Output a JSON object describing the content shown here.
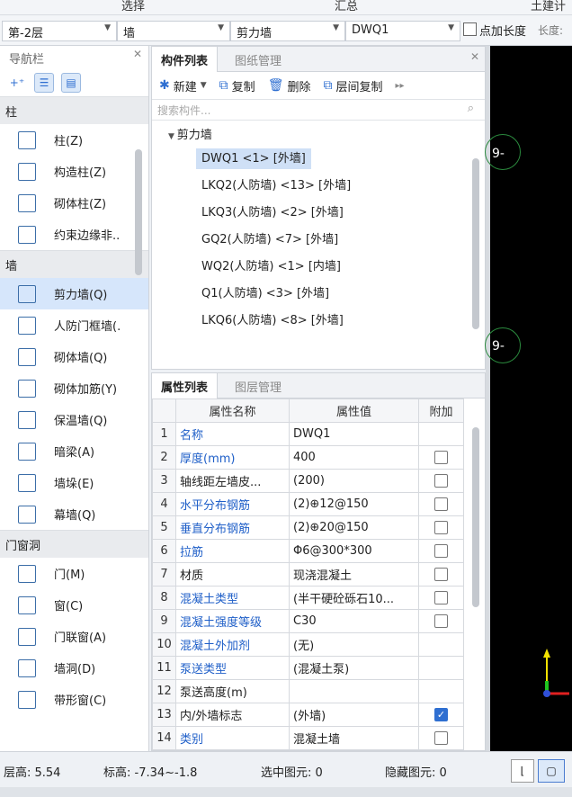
{
  "ribbon": {
    "labels": [
      "选择",
      "汇总",
      "土建计"
    ]
  },
  "selectors": {
    "floor": "第-2层",
    "category": "墙",
    "type": "剪力墙",
    "component": "DWQ1",
    "checkbox_label": "点加长度",
    "length_label": "长度:"
  },
  "nav": {
    "title": "导航栏",
    "categories": [
      {
        "name": "柱",
        "items": [
          "柱(Z)",
          "构造柱(Z)",
          "砌体柱(Z)",
          "约束边缘非.."
        ]
      },
      {
        "name": "墙",
        "items": [
          "剪力墙(Q)",
          "人防门框墙(.",
          "砌体墙(Q)",
          "砌体加筋(Y)",
          "保温墙(Q)",
          "暗梁(A)",
          "墙垛(E)",
          "幕墙(Q)"
        ]
      },
      {
        "name": "门窗洞",
        "items": [
          "门(M)",
          "窗(C)",
          "门联窗(A)",
          "墙洞(D)",
          "带形窗(C)"
        ]
      }
    ],
    "selected": "剪力墙(Q)"
  },
  "component_panel": {
    "tabs": [
      "构件列表",
      "图纸管理"
    ],
    "toolbar": {
      "new": "新建",
      "copy": "复制",
      "delete": "删除",
      "floor_copy": "层间复制"
    },
    "search_placeholder": "搜索构件...",
    "group": "剪力墙",
    "items": [
      "DWQ1 <1> [外墙]",
      "LKQ2(人防墙) <13> [外墙]",
      "LKQ3(人防墙) <2> [外墙]",
      "GQ2(人防墙) <7> [外墙]",
      "WQ2(人防墙) <1> [内墙]",
      "Q1(人防墙) <3> [外墙]",
      "LKQ6(人防墙) <8> [外墙]"
    ],
    "selected": "DWQ1 <1> [外墙]"
  },
  "property_panel": {
    "tabs": [
      "属性列表",
      "图层管理"
    ],
    "headers": [
      "属性名称",
      "属性值",
      "附加"
    ],
    "rows": [
      {
        "num": "1",
        "name": "名称",
        "value": "DWQ1",
        "blue": true,
        "checkbox": false,
        "has_cb": false
      },
      {
        "num": "2",
        "name": "厚度(mm)",
        "value": "400",
        "blue": true,
        "checkbox": false,
        "has_cb": true
      },
      {
        "num": "3",
        "name": "轴线距左墙皮...",
        "value": "(200)",
        "blue": false,
        "checkbox": false,
        "has_cb": true
      },
      {
        "num": "4",
        "name": "水平分布钢筋",
        "value": "(2)⊕12@150",
        "blue": true,
        "checkbox": false,
        "has_cb": true
      },
      {
        "num": "5",
        "name": "垂直分布钢筋",
        "value": "(2)⊕20@150",
        "blue": true,
        "checkbox": false,
        "has_cb": true
      },
      {
        "num": "6",
        "name": "拉筋",
        "value": "Φ6@300*300",
        "blue": true,
        "checkbox": false,
        "has_cb": true
      },
      {
        "num": "7",
        "name": "材质",
        "value": "现浇混凝土",
        "blue": false,
        "checkbox": false,
        "has_cb": true
      },
      {
        "num": "8",
        "name": "混凝土类型",
        "value": "(半干硬砼砾石10...",
        "blue": true,
        "checkbox": false,
        "has_cb": true
      },
      {
        "num": "9",
        "name": "混凝土强度等级",
        "value": "C30",
        "blue": true,
        "checkbox": false,
        "has_cb": true
      },
      {
        "num": "10",
        "name": "混凝土外加剂",
        "value": "(无)",
        "blue": true,
        "checkbox": false,
        "has_cb": false
      },
      {
        "num": "11",
        "name": "泵送类型",
        "value": "(混凝土泵)",
        "blue": true,
        "checkbox": false,
        "has_cb": false
      },
      {
        "num": "12",
        "name": "泵送高度(m)",
        "value": "",
        "blue": false,
        "checkbox": false,
        "has_cb": false
      },
      {
        "num": "13",
        "name": "内/外墙标志",
        "value": "(外墙)",
        "blue": false,
        "checkbox": true,
        "has_cb": true
      },
      {
        "num": "14",
        "name": "类别",
        "value": "混凝土墙",
        "blue": true,
        "checkbox": false,
        "has_cb": true
      }
    ]
  },
  "canvas": {
    "labels": [
      "9-",
      "9-"
    ]
  },
  "status": {
    "floor_height": "层高:  5.54",
    "elevation": "标高:  -7.34~-1.8",
    "selected": "选中图元: 0",
    "hidden": "隐藏图元: 0"
  }
}
